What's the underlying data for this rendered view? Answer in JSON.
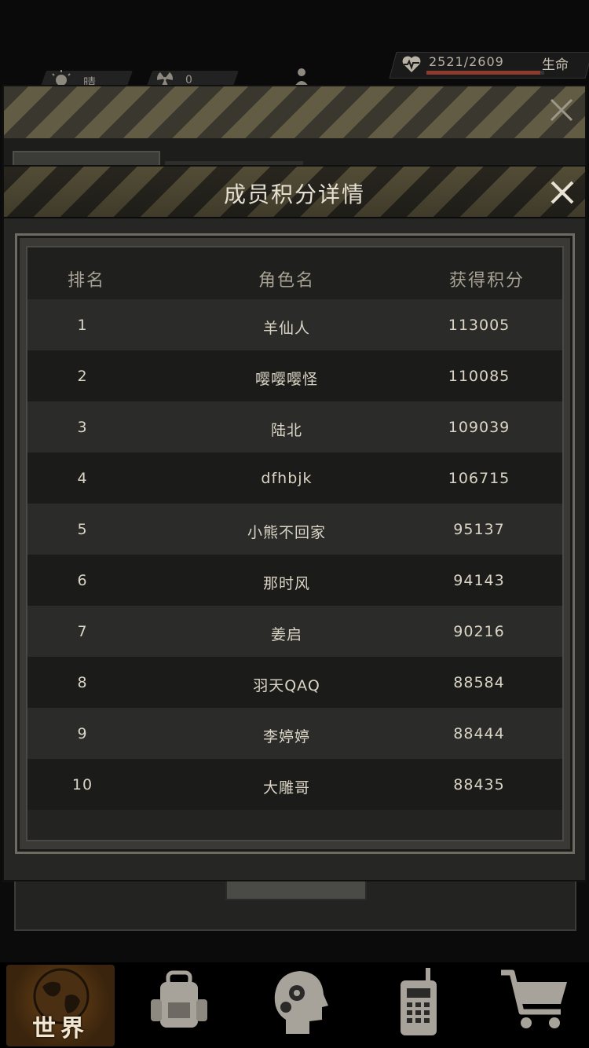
{
  "hud": {
    "weather": "晴",
    "radiation": "0",
    "hp": "2521/2609",
    "hp_label": "生命",
    "hp_ratio": 0.966
  },
  "modal": {
    "title": "成员积分详情",
    "columns": {
      "rank": "排名",
      "name": "角色名",
      "score": "获得积分"
    },
    "rows": [
      {
        "rank": "1",
        "name": "羊仙人",
        "score": "113005"
      },
      {
        "rank": "2",
        "name": "嘤嘤嘤怪",
        "score": "110085"
      },
      {
        "rank": "3",
        "name": "陆北",
        "score": "109039"
      },
      {
        "rank": "4",
        "name": "dfhbjk",
        "score": "106715"
      },
      {
        "rank": "5",
        "name": "小熊不回家",
        "score": "95137"
      },
      {
        "rank": "6",
        "name": "那时风",
        "score": "94143"
      },
      {
        "rank": "7",
        "name": "姜启",
        "score": "90216"
      },
      {
        "rank": "8",
        "name": "羽天QAQ",
        "score": "88584"
      },
      {
        "rank": "9",
        "name": "李婷婷",
        "score": "88444"
      },
      {
        "rank": "10",
        "name": "大雕哥",
        "score": "88435"
      }
    ]
  },
  "nav": {
    "world_label": "世界",
    "items": [
      "globe-icon",
      "backpack-icon",
      "skills-head-icon",
      "radio-icon",
      "shop-cart-icon"
    ]
  }
}
